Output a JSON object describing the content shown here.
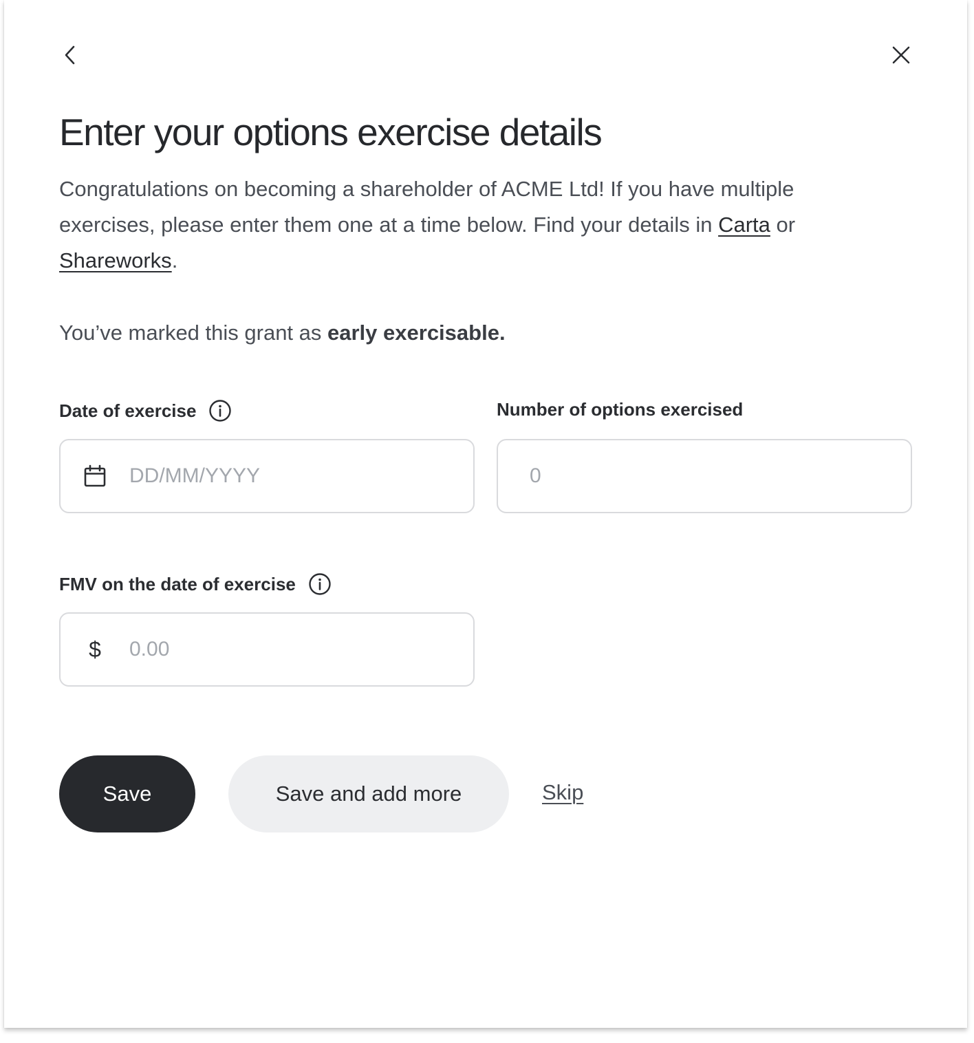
{
  "header": {
    "back_icon": "chevron-left-icon",
    "close_icon": "close-icon"
  },
  "title": "Enter your options exercise details",
  "intro": {
    "text_before": "Congratulations on becoming a shareholder of ACME Ltd! If you have multiple exercises, please enter them one at a time below. Find your details in ",
    "link_carta": "Carta",
    "text_middle": " or ",
    "link_shareworks": "Shareworks",
    "text_after": "."
  },
  "note": {
    "text": "You’ve marked this grant as ",
    "emphasis": "early exercisable."
  },
  "fields": {
    "date": {
      "label": "Date of exercise",
      "icon": "calendar-icon",
      "info_icon": "info-icon",
      "placeholder": "DD/MM/YYYY",
      "value": ""
    },
    "options": {
      "label": "Number of options exercised",
      "placeholder": "0",
      "value": ""
    },
    "fmv": {
      "label": "FMV on the date of exercise",
      "info_icon": "info-icon",
      "currency_symbol": "$",
      "placeholder": "0.00",
      "value": ""
    }
  },
  "actions": {
    "save_label": "Save",
    "save_more_label": "Save and add more",
    "skip_label": "Skip"
  },
  "colors": {
    "primary_button": "#27292d",
    "secondary_button": "#eeeff1",
    "input_border": "#d9dadd",
    "placeholder": "#a3a7ad"
  }
}
